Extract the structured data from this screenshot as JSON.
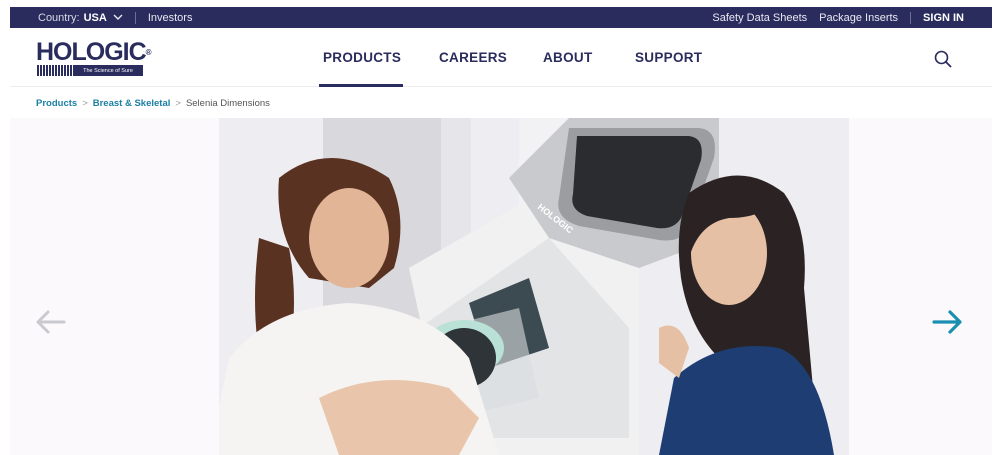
{
  "topbar": {
    "country_label": "Country:",
    "country_value": "USA",
    "investors": "Investors",
    "safety": "Safety Data Sheets",
    "inserts": "Package Inserts",
    "signin": "SIGN IN"
  },
  "logo": {
    "name": "HOLOGIC",
    "reg": "®",
    "tagline": "The Science of Sure"
  },
  "nav": [
    {
      "label": "PRODUCTS",
      "active": true
    },
    {
      "label": "CAREERS"
    },
    {
      "label": "ABOUT"
    },
    {
      "label": "SUPPORT"
    }
  ],
  "breadcrumb": {
    "items": [
      "Products",
      "Breast & Skeletal"
    ],
    "separator": ">",
    "current": "Selenia Dimensions"
  },
  "hero": {
    "device_brand": "HOLOGIC",
    "prev_arrow_color": "#c9c9cf",
    "next_arrow_color": "#1b8fb0"
  },
  "colors": {
    "brand_navy": "#2a2c5e",
    "link_teal": "#1b7fa3"
  }
}
